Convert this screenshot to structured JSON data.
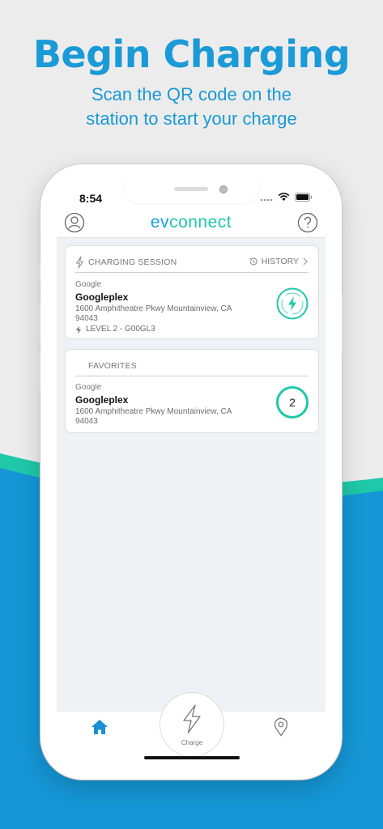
{
  "promo": {
    "headline": "Begin Charging",
    "subhead_line1": "Scan the QR code on the",
    "subhead_line2": "station to start your charge"
  },
  "colors": {
    "brand_blue": "#1a9ad6",
    "brand_teal": "#1fc8a8",
    "wave_blue": "#1596d5"
  },
  "status_bar": {
    "time": "8:54",
    "icons": [
      "signal-icon",
      "wifi-icon",
      "battery-icon"
    ]
  },
  "header": {
    "logo_part1": "ev",
    "logo_part2": "connect",
    "left_icon": "profile-icon",
    "right_icon": "help-icon"
  },
  "charging_session": {
    "title": "CHARGING SESSION",
    "history_label": "HISTORY",
    "network": "Google",
    "station": "Googleplex",
    "address_line1": "1600 Amphitheatre Pkwy Mountainview, CA",
    "address_line2": "94043",
    "level": "LEVEL 2 - G00GL3",
    "action_icon": "charging-bolt-icon"
  },
  "favorites": {
    "title": "FAVORITES",
    "network": "Google",
    "station": "Googleplex",
    "address_line1": "1600 Amphitheatre Pkwy Mountainview, CA",
    "address_line2": "94043",
    "available_count": "2"
  },
  "tabbar": {
    "home_icon": "home-icon",
    "charge_label": "Charge",
    "map_icon": "location-pin-icon"
  }
}
